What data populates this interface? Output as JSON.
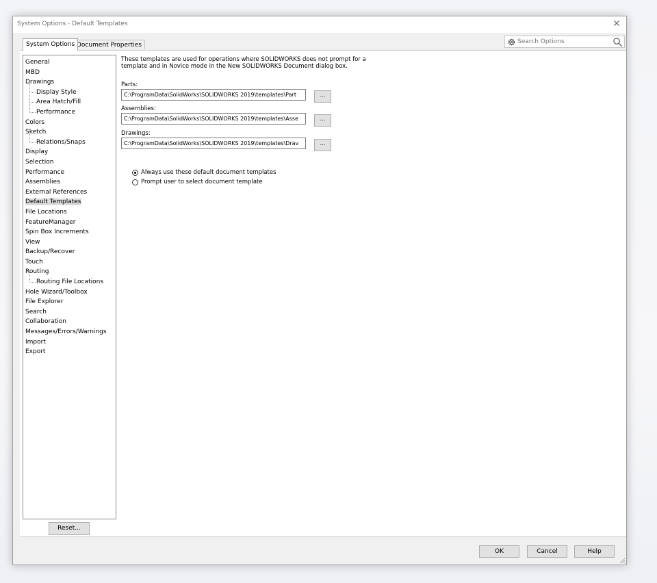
{
  "window": {
    "title": "System Options - Default Templates",
    "close_glyph": "✕"
  },
  "tabs": [
    {
      "label": "System Options",
      "active": true
    },
    {
      "label": "Document Properties",
      "active": false
    }
  ],
  "search": {
    "placeholder": "Search Options",
    "icon": "gear-icon",
    "search_icon": "magnifier-icon"
  },
  "tree": {
    "items": [
      {
        "label": "General",
        "level": 0
      },
      {
        "label": "MBD",
        "level": 0
      },
      {
        "label": "Drawings",
        "level": 0
      },
      {
        "label": "Display Style",
        "level": 1
      },
      {
        "label": "Area Hatch/Fill",
        "level": 1
      },
      {
        "label": "Performance",
        "level": 1
      },
      {
        "label": "Colors",
        "level": 0
      },
      {
        "label": "Sketch",
        "level": 0
      },
      {
        "label": "Relations/Snaps",
        "level": 1
      },
      {
        "label": "Display",
        "level": 0
      },
      {
        "label": "Selection",
        "level": 0
      },
      {
        "label": "Performance",
        "level": 0
      },
      {
        "label": "Assemblies",
        "level": 0
      },
      {
        "label": "External References",
        "level": 0
      },
      {
        "label": "Default Templates",
        "level": 0,
        "selected": true
      },
      {
        "label": "File Locations",
        "level": 0
      },
      {
        "label": "FeatureManager",
        "level": 0
      },
      {
        "label": "Spin Box Increments",
        "level": 0
      },
      {
        "label": "View",
        "level": 0
      },
      {
        "label": "Backup/Recover",
        "level": 0
      },
      {
        "label": "Touch",
        "level": 0
      },
      {
        "label": "Routing",
        "level": 0
      },
      {
        "label": "Routing File Locations",
        "level": 1
      },
      {
        "label": "Hole Wizard/Toolbox",
        "level": 0
      },
      {
        "label": "File Explorer",
        "level": 0
      },
      {
        "label": "Search",
        "level": 0
      },
      {
        "label": "Collaboration",
        "level": 0
      },
      {
        "label": "Messages/Errors/Warnings",
        "level": 0
      },
      {
        "label": "Import",
        "level": 0
      },
      {
        "label": "Export",
        "level": 0
      }
    ]
  },
  "main": {
    "description": "These templates are used for operations where SOLIDWORKS does not prompt for a template and in Novice mode in the New SOLIDWORKS Document dialog box.",
    "fields": {
      "parts": {
        "label": "Parts:",
        "value": "C:\\ProgramData\\SolidWorks\\SOLIDWORKS 2019\\templates\\Part",
        "browse": "..."
      },
      "assemblies": {
        "label": "Assemblies:",
        "value": "C:\\ProgramData\\SolidWorks\\SOLIDWORKS 2019\\templates\\Asse",
        "browse": "..."
      },
      "drawings": {
        "label": "Drawings:",
        "value": "C:\\ProgramData\\SolidWorks\\SOLIDWORKS 2019\\templates\\Drav",
        "browse": "..."
      }
    },
    "radios": {
      "always": {
        "label": "Always use these default document templates",
        "checked": true
      },
      "prompt": {
        "label": "Prompt user to select document template",
        "checked": false
      }
    }
  },
  "buttons": {
    "reset": "Reset...",
    "ok": "OK",
    "cancel": "Cancel",
    "help": "Help"
  }
}
